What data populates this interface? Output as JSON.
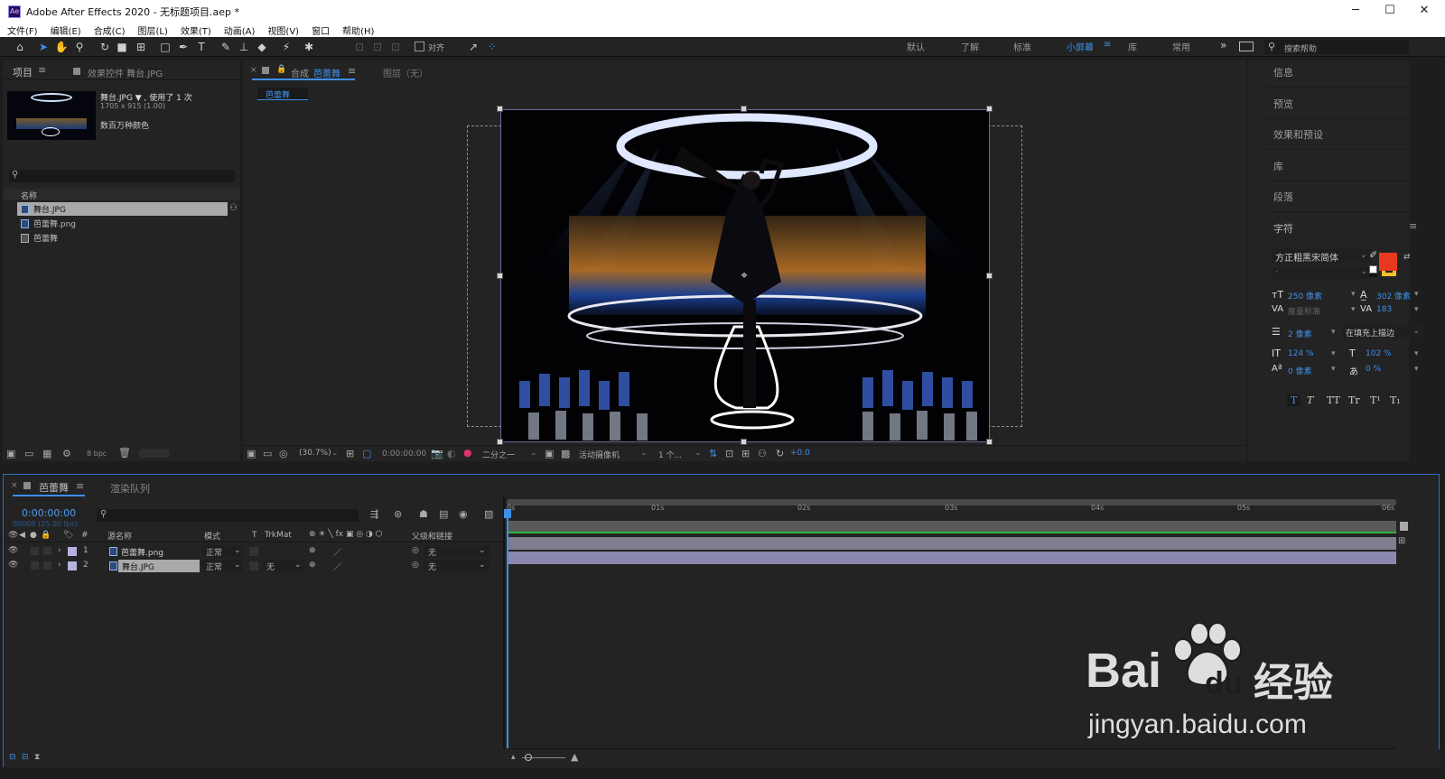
{
  "window": {
    "title": "Adobe After Effects 2020 - 无标题项目.aep *",
    "logo": "Ae",
    "minimize": "─",
    "maximize": "☐",
    "close": "✕"
  },
  "menu": [
    "文件(F)",
    "编辑(E)",
    "合成(C)",
    "图层(L)",
    "效果(T)",
    "动画(A)",
    "视图(V)",
    "窗口",
    "帮助(H)"
  ],
  "toolbar": {
    "align_label": "对齐",
    "workspaces": [
      "默认",
      "了解",
      "标准",
      "小屏幕",
      "库",
      "常用"
    ],
    "active_workspace": "小屏幕",
    "more": "»",
    "search_placeholder": "搜索帮助"
  },
  "project_panel": {
    "tab": "项目",
    "tab2": "效果控件 舞台.JPG",
    "preview": {
      "name": "舞台.JPG ▼ , 使用了 1 次",
      "dims": "1705 x 915 (1.00)",
      "colors": "数百万种颜色"
    },
    "search_placeholder": "",
    "column": "名称",
    "items": [
      {
        "name": "舞台.JPG",
        "selected": true
      },
      {
        "name": "芭蕾舞.png",
        "selected": false
      },
      {
        "name": "芭蕾舞",
        "selected": false
      }
    ],
    "bpc": "8 bpc"
  },
  "comp_panel": {
    "tab_prefix": "合成",
    "tab_name": "芭蕾舞",
    "layer_tab": "图层（无）",
    "sub_tab": "芭蕾舞",
    "zoom": "(30.7%)",
    "timecode": "0:00:00:00",
    "resolution": "二分之一",
    "camera": "活动摄像机",
    "views": "1 个...",
    "exposure": "+0.0"
  },
  "right_panel": {
    "items": [
      "信息",
      "预览",
      "效果和预设",
      "库",
      "段落",
      "字符"
    ],
    "font_family": "方正粗黑宋简体",
    "font_style": "-",
    "font_size": "250 像素",
    "leading": "302 像素",
    "kerning": "度量标准",
    "tracking": "183",
    "stroke_width": "2 像素",
    "stroke_type": "在填充上描边",
    "vert_scale": "124 %",
    "horiz_scale": "102 %",
    "baseline": "0 像素",
    "tsume": "0 %",
    "fill_color": "#e8391e",
    "stroke_color": "#f2c12e",
    "styles": [
      "T",
      "T",
      "TT",
      "Tr",
      "T¹",
      "T₁"
    ]
  },
  "timeline": {
    "tab": "芭蕾舞",
    "render_tab": "渲染队列",
    "timecode": "0:00:00:00",
    "frame_info": "00000 (25.00 fps)",
    "headers": {
      "num": "#",
      "source": "源名称",
      "mode": "模式",
      "t": "T",
      "trkmat": "TrkMat",
      "parent": "父级和链接"
    },
    "layers": [
      {
        "num": "1",
        "name": "芭蕾舞.png",
        "mode": "正常",
        "trkmat": "",
        "parent": "无",
        "selected": false
      },
      {
        "num": "2",
        "name": "舞台.JPG",
        "mode": "正常",
        "trkmat": "无",
        "parent": "无",
        "selected": true
      }
    ],
    "ruler": [
      "0s",
      "01s",
      "02s",
      "03s",
      "04s",
      "05s",
      "06s"
    ]
  },
  "watermark": {
    "brand": "Bai",
    "brand2": "du",
    "cn": "经验",
    "url": "jingyan.baidu.com"
  }
}
